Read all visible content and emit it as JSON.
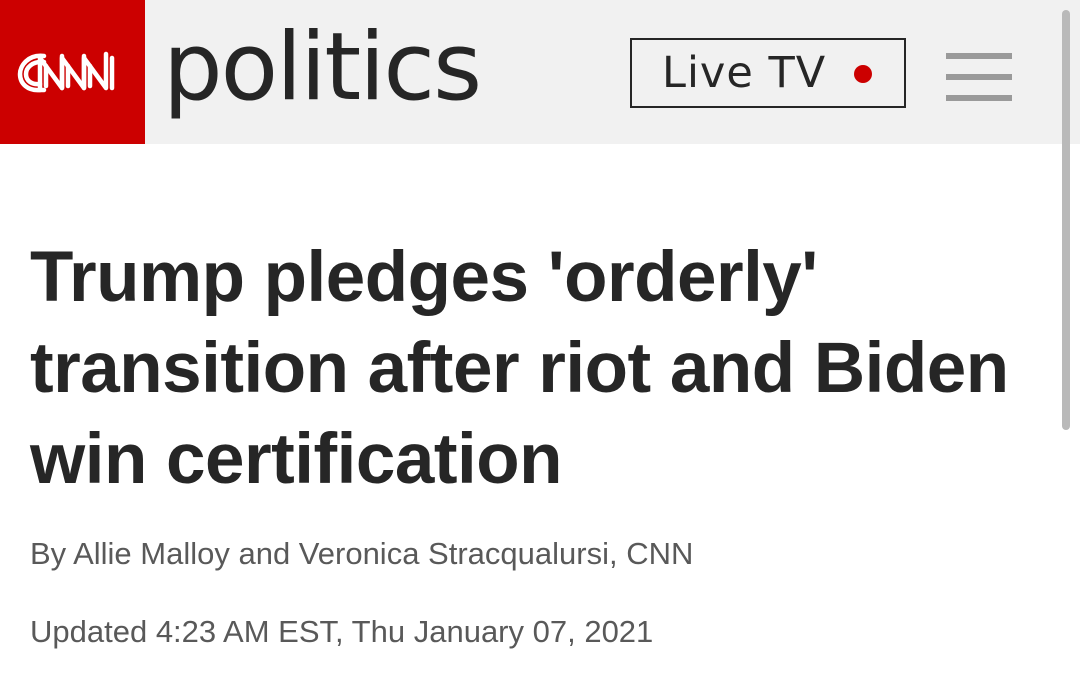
{
  "header": {
    "logo_text": "CNN",
    "section_name": "politics",
    "live_tv_label": "Live TV",
    "menu_icon": "hamburger-menu-icon",
    "live_indicator_color": "#cc0000",
    "brand_color": "#cc0000"
  },
  "article": {
    "headline": "Trump pledges 'orderly' transition after riot and Biden win certification",
    "byline": "By Allie Malloy and Veronica Stracqualursi, CNN",
    "timestamp": "Updated 4:23 AM EST, Thu January 07, 2021"
  }
}
